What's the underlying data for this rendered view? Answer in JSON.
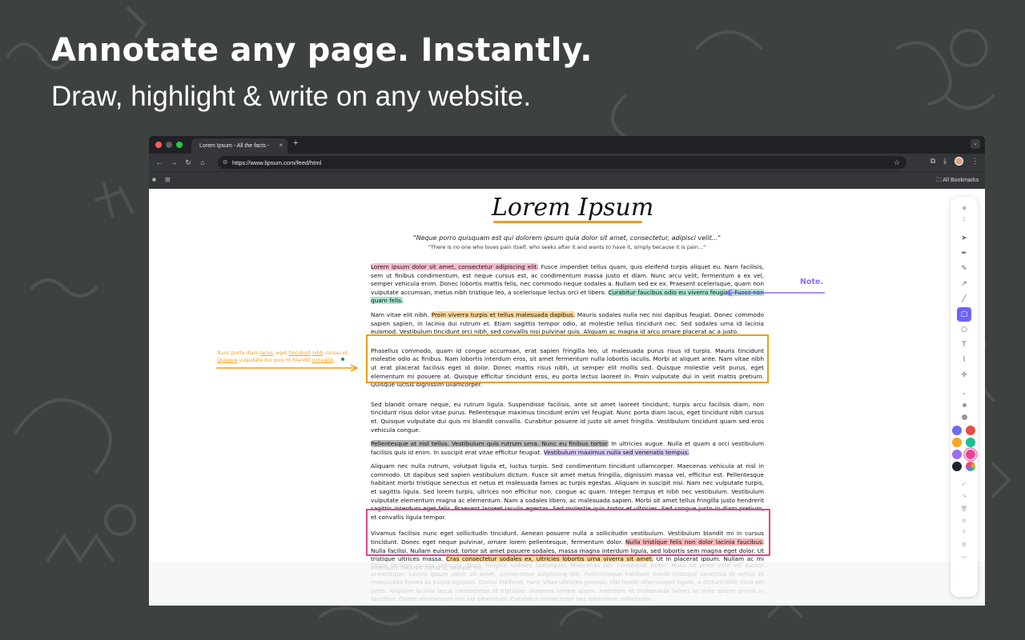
{
  "hero": {
    "title": "Annotate any page. Instantly.",
    "subtitle": "Draw, highlight & write on any website."
  },
  "browser": {
    "tab_title": "Lorem Ipsum - All the facts -",
    "tab_close": "×",
    "new_tab": "+",
    "url": "https://www.lipsum.com/feed/html",
    "bookmarks_label": "All Bookmarks",
    "icons": [
      "back-icon",
      "forward-icon",
      "reload-icon",
      "home-icon",
      "tune-icon",
      "star-icon",
      "extensions-icon",
      "download-icon",
      "profile-avatar",
      "menu-icon"
    ]
  },
  "page": {
    "logo": "Lorem Ipsum",
    "quote": "\"Neque porro quisquam est qui dolorem ipsum quia dolor sit amet, consectetur, adipisci velit...\"",
    "quote_translation": "\"There is no one who loves pain itself, who seeks after it and wants to have it, simply because it is pain...\"",
    "p1": {
      "hl1": "Lorem ipsum dolor sit amet, consectetur adipiscing elit.",
      "t1": " Fusce imperdiet tellus quam, quis eleifend turpis aliquet eu. Nam facilisis, sem ut finibus condimentum, est neque cursus est, ac condimentum massa justo et diam. Nunc arcu velit, fermentum a ex vel, semper vehicula enim. Donec lobortis mattis felis, nec commodo neque sodales a. Nullam sed ex ex. Praesent scelerisque, quam non vulputate accumsan, metus nibh tristique leo, a scelerisque lectus orci et libero. ",
      "hl2": "Curabitur faucibus odio eu viverra feugiat. Fusce non quam felis."
    },
    "p2": {
      "t1": "Nam vitae elit nibh. ",
      "hl1": "Proin viverra turpis et tellus malesuada dapibus.",
      "t2": " Mauris sodales nulla nec nisi dapibus feugiat. Donec commodo sapien sapien, in lacinia dui rutrum et. Etiam sagittis tempor odio, at molestie tellus tincidunt nec. Sed sodales urna id lacinia euismod. Vestibulum tincidunt orci nibh, sed convallis nisi pulvinar quis. Aliquam ac magna id arcu ornare placerat ac a justo."
    },
    "p3": "Phasellus commodo, quam id congue accumsan, erat sapien fringilla leo, ut malesuada purus risus id turpis. Mauris tincidunt molestie odio ac finibus. Nam lobortis interdum eros, sit amet fermentum nulla lobortis iaculis. Morbi at aliquet ante. Nam vitae nibh ut erat placerat facilisis eget id dolor. Donec mattis risus nibh, ut semper elit mollis sed. Quisque molestie velit purus, eget elementum mi posuere at. Quisque efficitur tincidunt eros, eu porta lectus laoreet in. Proin vulputate dui in velit mattis pretium. Quisque luctus dignissim ullamcorper.",
    "p4": "Sed blandit ornare neque, eu rutrum ligula. Suspendisse facilisis, ante sit amet laoreet tincidunt, turpis arcu facilisis diam, non tincidunt risus dolor vitae purus. Pellentesque maximus tincidunt enim vel feugiat. Nunc porta diam lacus, eget tincidunt nibh cursus et. Quisque vulputate dui quis mi blandit convallis. Curabitur posuere id justo sit amet fringilla. Vestibulum tincidunt quam sed eros vehicula congue.",
    "p5": {
      "hl1": "Pellentesque at nisl tellus. Vestibulum quis rutrum urna. Nunc eu finibus tortor.",
      "t1": " In ultricies augue. Nulla et quam a orci vestibulum facilisis quis id enim. In suscipit erat vitae efficitur feugiat. ",
      "hl2": "Vestibulum maximus nulla sed venenatis tempus."
    },
    "p6": "Aliquam nec nulla rutrum, volutpat ligula et, luctus turpis. Sed condimentum tincidunt ullamcorper. Maecenas vehicula at nisl in commodo. Ut dapibus sed sapien vestibulum dictum. Fusce sit amet metus fringilla, dignissim massa vel, efficitur est. Pellentesque habitant morbi tristique senectus et netus et malesuada fames ac turpis egestas. Aliquam in suscipit nisi. Nam nec vulputate turpis, et sagittis ligula. Sed lorem turpis, ultrices non efficitur non, congue ac quam. Integer tempus et nibh nec vestibulum. Vestibulum vulputate elementum magna ac elementum. Nam a sodales libero, ac malesuada sapien. Morbi sit amet tellus fringilla justo hendrerit sagittis interdum eget felis. Praesent laoreet iaculis egestas. Sed molestie quis tortor et ultricies. Sed congue justo in diam pretium, et convallis ligula tempor.",
    "p7": {
      "t1": "Vivamus facilisis nunc eget sollicitudin tincidunt. Aenean posuere nulla a sollicitudin vestibulum. Vestibulum blandit mi in cursus tincidunt. Donec eget neque pulvinar, ornare lorem pellentesque, fermentum dolor. ",
      "hl1": "Nulla tristique felis non dolor lacinia faucibus.",
      "t2": " Nulla facilisi. Nullam euismod, tortor sit amet posuere sodales, massa magna interdum ligula, sed lobortis sem magna eget dolor. Ut tristique ultrices massa. ",
      "hl2": "Cras consectetur sodales ex, ultricies lobortis urna viverra sit amet.",
      "t3": " Ut in placerat ipsum. Nullam ac mi interdum, facilisis tortor a, semper mi."
    },
    "p8_faded": "Etiam facilisis cursus vehicula. Nunc fringilla sodales consequat. Maecenas nec consequat tortor. Nulla sit amet velit vel auctor scelerisque. Lorem ipsum dolor sit amet, consectetur adipiscing elit. Pellentesque habitant morbi tristique senectus et netus et malesuada fames ac turpis egestas. Donec eleifend, nunc vitae ultricies gravida, nisi lorem ullamcorper ligula, a dictum nibh risus vel justo. Aliquam lacinia lacus consectetur id tristique. Vivamus ornare quam, interdum et malesuada fames ac ante ipsum primis in faucibus. Donec elementum nisi vel bibendum. Curabitur consectetur nec bibendum sollicitudin."
  },
  "annotations": {
    "note_label": "Note.",
    "side_note_parts": [
      "Nunc porta diam ",
      "lacus",
      ", eget ",
      "tincidunt",
      " ",
      "nibh",
      " cursus et. ",
      "Quisque",
      " vulputate dui quis mi blandit ",
      "convallis",
      "."
    ],
    "colors": {
      "orange": "#f39c12",
      "pink": "#e84393",
      "purple": "#8e6ef0"
    }
  },
  "toolbar_panel": {
    "tools": [
      "eye-icon",
      "drag-handle-icon",
      "cursor-icon",
      "pen-nib-icon",
      "pencil-icon",
      "arrow-icon",
      "line-icon",
      "rectangle-icon",
      "circle-icon",
      "text-icon",
      "highlighter-icon",
      "laser-icon"
    ],
    "active_tool": "rectangle-icon",
    "colors": [
      "#6c6cf0",
      "#e84c4c",
      "#f5a623",
      "#1fbf8f",
      "#9b6cf5",
      "#e84393",
      "#1f2330",
      "rainbow"
    ],
    "selected_color": "#e84393",
    "bottom_tools": [
      "undo-icon",
      "redo-icon",
      "trash-icon",
      "clear-icon",
      "camera-icon",
      "settings-icon",
      "display-icon"
    ]
  }
}
